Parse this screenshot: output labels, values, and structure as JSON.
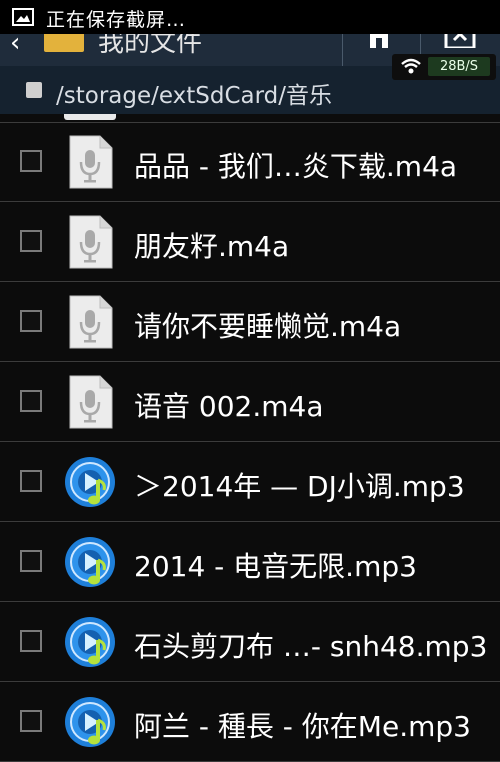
{
  "status_bar": {
    "notification": "正在保存截屏…",
    "net_speed": "28B/S"
  },
  "header": {
    "title": "我的文件"
  },
  "path_bar": {
    "path": "/storage/extSdCard/音乐"
  },
  "files": [
    {
      "name": "品品 - 我们…炎下载.m4a",
      "icon": "audio-document-icon"
    },
    {
      "name": "朋友籽.m4a",
      "icon": "audio-document-icon"
    },
    {
      "name": "请你不要睡懒觉.m4a",
      "icon": "audio-document-icon"
    },
    {
      "name": "语音 002.m4a",
      "icon": "audio-document-icon"
    },
    {
      "name": "＞2014年 — DJ小调.mp3",
      "icon": "music-player-icon"
    },
    {
      "name": "2014  -  电音无限.mp3",
      "icon": "music-player-icon"
    },
    {
      "name": "石头剪刀布 …- snh48.mp3",
      "icon": "music-player-icon"
    },
    {
      "name": "阿兰 - 種長 - 你在Me.mp3",
      "icon": "music-player-icon"
    }
  ],
  "colors": {
    "background": "#0b0b0b",
    "action_bar": "#1f2c3b",
    "path_bar": "#15222f",
    "music_icon_blue": "#1e7fd9",
    "music_icon_green": "#b6e23d"
  }
}
